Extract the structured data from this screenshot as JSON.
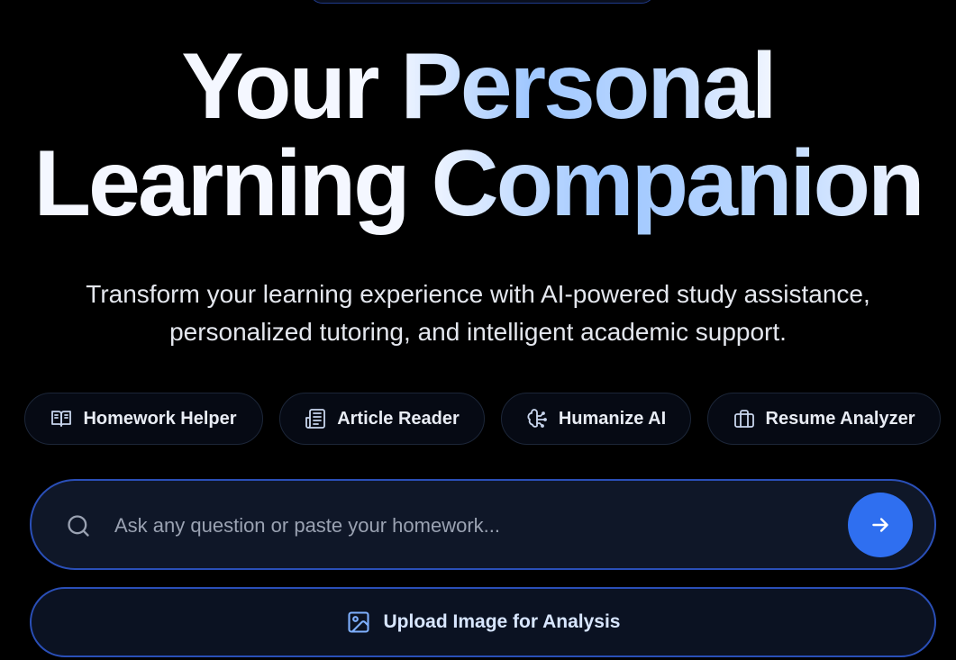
{
  "hero": {
    "title_line1_plain": "Your ",
    "title_line1_accent": "Personal",
    "title_line2_plain": "Learning ",
    "title_line2_accent": "Companion",
    "subtitle_line1": "Transform your learning experience with AI-powered study assistance,",
    "subtitle_line2": "personalized tutoring, and intelligent academic support."
  },
  "tools": [
    {
      "label": "Homework Helper",
      "icon": "open-book-icon"
    },
    {
      "label": "Article Reader",
      "icon": "newspaper-icon"
    },
    {
      "label": "Humanize AI",
      "icon": "brain-icon"
    },
    {
      "label": "Resume Analyzer",
      "icon": "briefcase-icon"
    }
  ],
  "search": {
    "placeholder": "Ask any question or paste your homework...",
    "value": "",
    "icon": "search-icon",
    "submit_icon": "arrow-right-icon"
  },
  "upload": {
    "label": "Upload Image for Analysis",
    "icon": "image-icon"
  },
  "colors": {
    "background": "#000000",
    "accent": "#2f6ff0",
    "border_accent": "#2a4fb8",
    "title_gradient_light": "#9fc7ff"
  }
}
